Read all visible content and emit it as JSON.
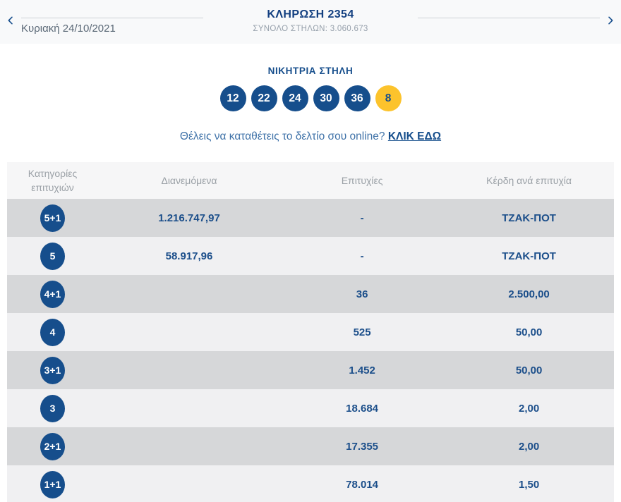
{
  "header": {
    "draw_title": "ΚΛΗΡΩΣΗ 2354",
    "total_columns": "ΣΥΝΟΛΟ ΣΤΗΛΩΝ: 3.060.673",
    "draw_date": "Κυριακή 24/10/2021"
  },
  "winning_column": {
    "title": "ΝΙΚΗΤΡΙΑ ΣΤΗΛΗ",
    "numbers": [
      "12",
      "22",
      "24",
      "30",
      "36"
    ],
    "bonus_number": "8"
  },
  "online_cta": {
    "question": "Θέλεις να καταθέτεις το δελτίο σου online? ",
    "link_label": "ΚΛΙΚ ΕΔΩ"
  },
  "results_table": {
    "columns": [
      "Κατηγορίες επιτυχιών",
      "Διανεμόμενα",
      "Επιτυχίες",
      "Κέρδη ανά επιτυχία"
    ],
    "rows": [
      {
        "category": "5+1",
        "distributed": "1.216.747,97",
        "winners": "-",
        "prize": "ΤΖΑΚ-ΠΟΤ"
      },
      {
        "category": "5",
        "distributed": "58.917,96",
        "winners": "-",
        "prize": "ΤΖΑΚ-ΠΟΤ"
      },
      {
        "category": "4+1",
        "distributed": "",
        "winners": "36",
        "prize": "2.500,00"
      },
      {
        "category": "4",
        "distributed": "",
        "winners": "525",
        "prize": "50,00"
      },
      {
        "category": "3+1",
        "distributed": "",
        "winners": "1.452",
        "prize": "50,00"
      },
      {
        "category": "3",
        "distributed": "",
        "winners": "18.684",
        "prize": "2,00"
      },
      {
        "category": "2+1",
        "distributed": "",
        "winners": "17.355",
        "prize": "2,00"
      },
      {
        "category": "1+1",
        "distributed": "",
        "winners": "78.014",
        "prize": "1,50"
      }
    ]
  },
  "colors": {
    "primary_blue": "#164e8c",
    "title_blue": "#123f80",
    "bonus_yellow": "#fcc32c",
    "row_light": "#f0f0f2",
    "row_dark": "#d6d7d9",
    "header_gray_text": "#9aa0a6",
    "top_bar_bg": "#f8f9fa"
  }
}
